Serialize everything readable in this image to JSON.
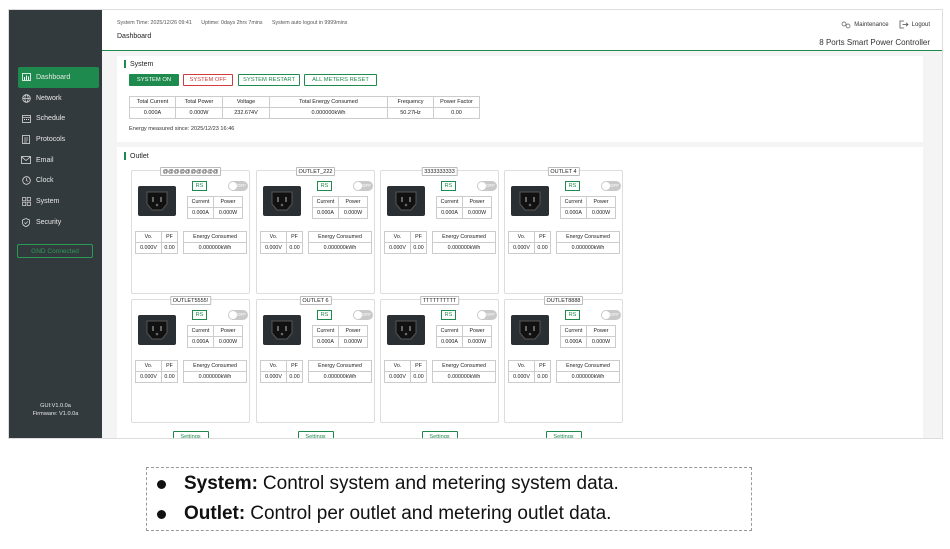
{
  "sidebar": {
    "items": [
      {
        "label": "Dashboard",
        "icon": "dashboard-icon"
      },
      {
        "label": "Network",
        "icon": "globe-icon"
      },
      {
        "label": "Schedule",
        "icon": "calendar-icon"
      },
      {
        "label": "Protocols",
        "icon": "document-icon"
      },
      {
        "label": "Email",
        "icon": "mail-icon"
      },
      {
        "label": "Clock",
        "icon": "clock-icon"
      },
      {
        "label": "System",
        "icon": "grid-icon"
      },
      {
        "label": "Security",
        "icon": "shield-icon"
      }
    ],
    "gnd_status": "GND Connected",
    "gui_version": "GUI:V1.0.0a",
    "firmware_version": "Firmware: V1.0.0a"
  },
  "header": {
    "system_time": "System Time: 2025/12/26 09:41",
    "uptime": "Uptime: 0days 2hrs 7mins",
    "auto_logout": "System auto logout in 9999mins",
    "page_title": "Dashboard",
    "maintenance": "Maintenance",
    "logout": "Logout",
    "product_name": "8 Ports Smart Power Controller"
  },
  "system": {
    "title": "System",
    "buttons": {
      "on": "SYSTEM ON",
      "off": "SYSTEM OFF",
      "restart": "SYSTEM RESTART",
      "reset": "ALL METERS RESET"
    },
    "headers": [
      "Total Current",
      "Total Power",
      "Voltage",
      "Total Energy Consumed",
      "Frequency",
      "Power Factor"
    ],
    "values": [
      "0.000A",
      "0.000W",
      "232.674V",
      "0.000000kWh",
      "50.27Hz",
      "0.00"
    ],
    "energy_note": "Energy measured since: 2025/12/23 16:46"
  },
  "outlet": {
    "title": "Outlet",
    "labels": {
      "rs": "RS",
      "toggle": "OFF",
      "current": "Current",
      "power": "Power",
      "vo": "Vo.",
      "pf": "PF",
      "energy": "Energy Consumed",
      "settings": "Settings"
    },
    "cards": [
      {
        "name": "@@@@@@@@@@",
        "current": "0.000A",
        "power": "0.000W",
        "vo": "0.000V",
        "pf": "0.00",
        "energy": "0.000000kWh"
      },
      {
        "name": "OUTLET_222",
        "current": "0.000A",
        "power": "0.000W",
        "vo": "0.000V",
        "pf": "0.00",
        "energy": "0.000000kWh"
      },
      {
        "name": "3333333333",
        "current": "0.000A",
        "power": "0.000W",
        "vo": "0.000V",
        "pf": "0.00",
        "energy": "0.000000kWh"
      },
      {
        "name": "OUTLET 4",
        "current": "0.000A",
        "power": "0.000W",
        "vo": "0.000V",
        "pf": "0.00",
        "energy": "0.000000kWh"
      },
      {
        "name": "OUTLET5555!",
        "current": "0.000A",
        "power": "0.000W",
        "vo": "0.000V",
        "pf": "0.00",
        "energy": "0.000000kWh"
      },
      {
        "name": "OUTLET 6",
        "current": "0.000A",
        "power": "0.000W",
        "vo": "0.000V",
        "pf": "0.00",
        "energy": "0.000000kWh"
      },
      {
        "name": "TTTTTTTTTT",
        "current": "0.000A",
        "power": "0.000W",
        "vo": "0.000V",
        "pf": "0.00",
        "energy": "0.000000kWh"
      },
      {
        "name": "OUTLET8888",
        "current": "0.000A",
        "power": "0.000W",
        "vo": "0.000V",
        "pf": "0.00",
        "energy": "0.000000kWh"
      }
    ]
  },
  "legend": {
    "items": [
      {
        "term": "System:",
        "text": "Control system and metering system data."
      },
      {
        "term": "Outlet:",
        "text": "Control per outlet and metering outlet data."
      }
    ]
  },
  "colors": {
    "accent": "#1e8a4d",
    "danger": "#d23b3b",
    "sidebar": "#333a3e"
  }
}
